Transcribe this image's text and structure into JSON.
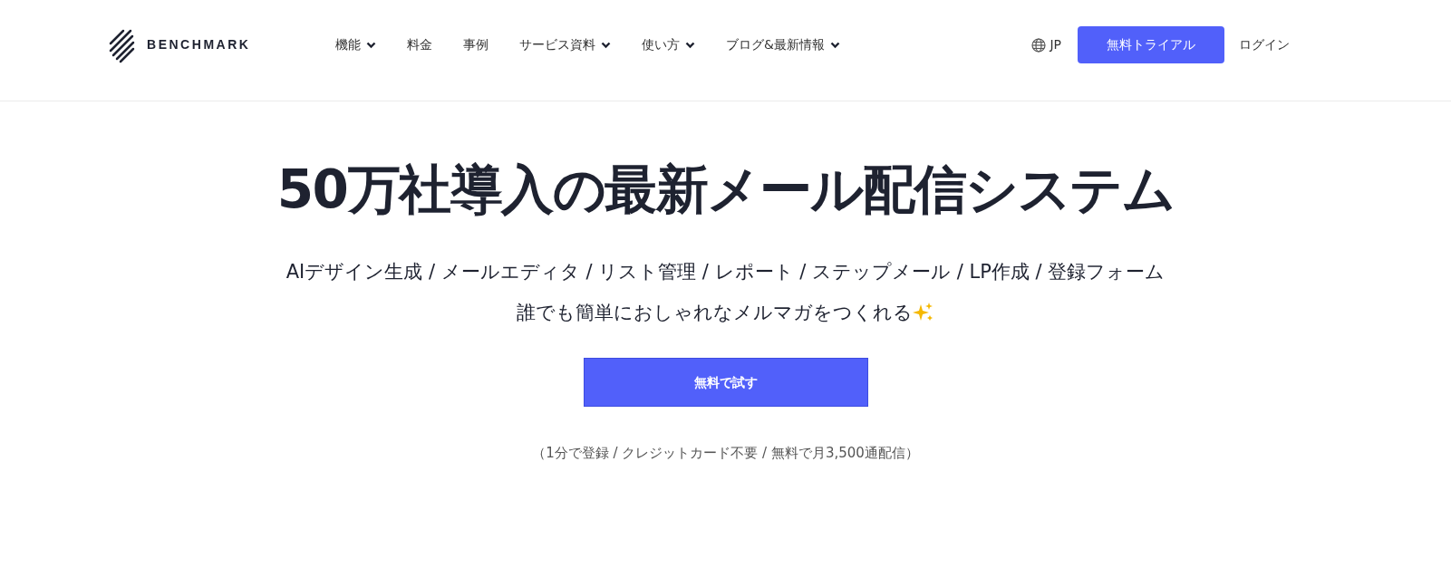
{
  "header": {
    "logo": "BENCHMARK",
    "nav": [
      {
        "label": "機能",
        "dropdown": true
      },
      {
        "label": "料金",
        "dropdown": false
      },
      {
        "label": "事例",
        "dropdown": false
      },
      {
        "label": "サービス資料",
        "dropdown": true
      },
      {
        "label": "使い方",
        "dropdown": true
      },
      {
        "label": "ブログ&最新情報",
        "dropdown": true
      }
    ],
    "language": "JP",
    "trial_button": "無料トライアル",
    "login": "ログイン"
  },
  "hero": {
    "title": "50万社導入の最新メール配信システム",
    "features": "AIデザイン生成 / メールエディタ / リスト管理 / レポート / ステップメール / LP作成 / 登録フォーム",
    "tagline": "誰でも簡単におしゃれなメルマガをつくれる",
    "cta_button": "無料で試す",
    "note": "（1分で登録 / クレジットカード不要 / 無料で月3,500通配信）"
  }
}
